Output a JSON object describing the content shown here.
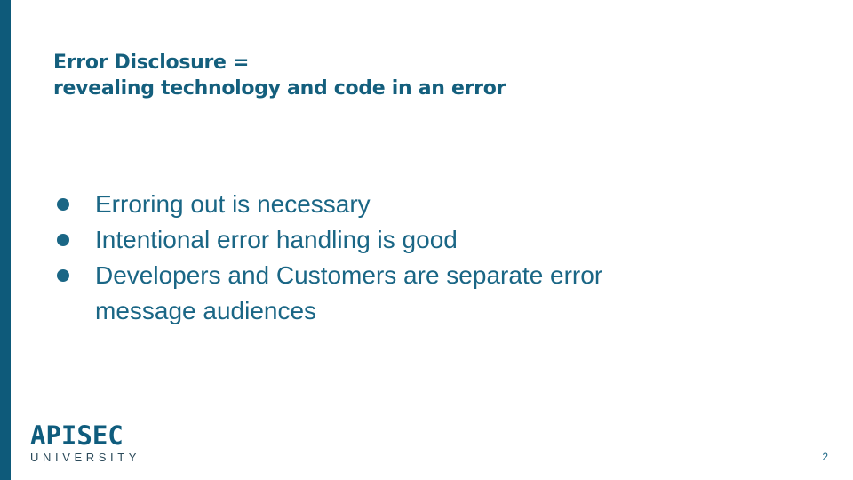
{
  "slide": {
    "title_lines": [
      "Error Disclosure =",
      "revealing technology and code in an error"
    ],
    "bullets": [
      "Erroring out is necessary",
      "Intentional error handling is good",
      "Developers and Customers are separate error message audiences"
    ],
    "logo": {
      "main": "APISEC",
      "sub": "UNIVERSITY"
    },
    "page_number": "2"
  },
  "colors": {
    "accent_bar": "#0e5a7a",
    "title": "#145f7d",
    "body_text": "#1a6685",
    "background": "#ffffff"
  },
  "icons": {
    "bullet": "filled-circle"
  }
}
